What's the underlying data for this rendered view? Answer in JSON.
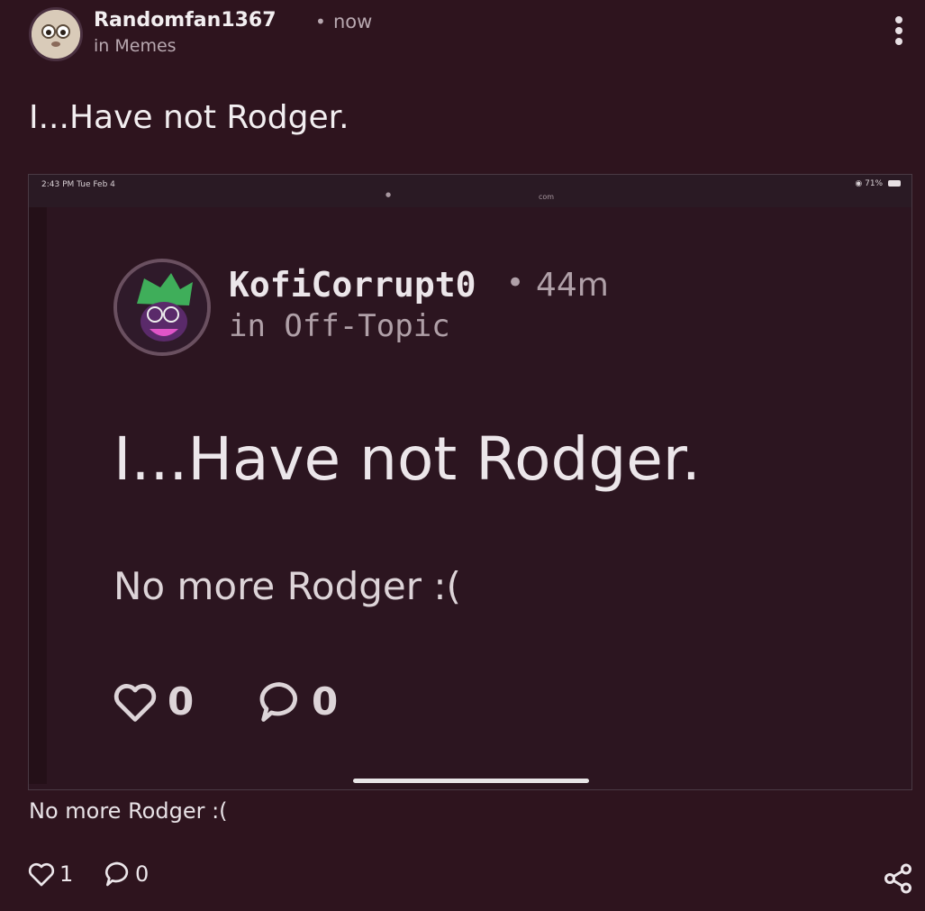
{
  "post": {
    "author": "Randomfan1367",
    "separator": "•",
    "time": "now",
    "community": "in Memes",
    "title": "I...Have not Rodger.",
    "caption": "No more Rodger :(",
    "likes": "1",
    "comments": "0",
    "icons": {
      "more": "more-vertical-icon",
      "like": "heart-icon",
      "comment": "comment-icon",
      "share": "share-icon"
    }
  },
  "screenshot": {
    "status_time": "2:43 PM   Tue Feb 4",
    "status_right": "71%",
    "url": "com",
    "author": "KofiCorrupt0",
    "separator": "•",
    "time": "44m",
    "community": "in Off-Topic",
    "title": "I...Have not Rodger.",
    "body": "No more Rodger :(",
    "likes": "0",
    "comments": "0"
  },
  "colors": {
    "background": "#2e141e",
    "text": "#f2eef0",
    "muted": "#b8a8b0"
  }
}
